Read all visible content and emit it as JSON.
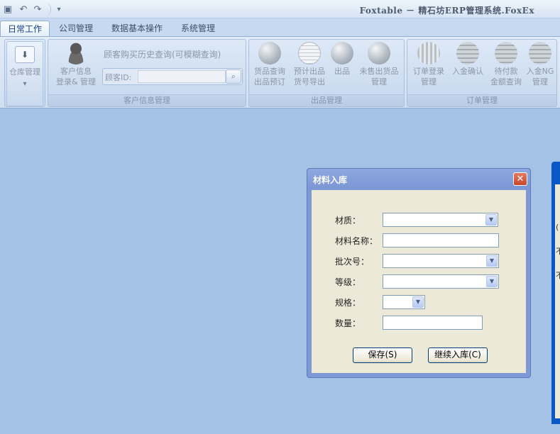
{
  "window": {
    "title": "Foxtable － 精石坊ERP管理系统.FoxEx"
  },
  "quick_access": {
    "icons": [
      "save-icon",
      "undo-icon",
      "redo-icon",
      "customize-icon"
    ]
  },
  "tabs": [
    {
      "label": "日常工作",
      "active": true
    },
    {
      "label": "公司管理",
      "active": false
    },
    {
      "label": "数据基本操作",
      "active": false
    },
    {
      "label": "系统管理",
      "active": false
    }
  ],
  "ribbon": {
    "warehouse_button": {
      "label": "仓库管理",
      "arrow": "▾",
      "icon": "download-icon"
    },
    "customer_group": {
      "caption": "客户信息管理",
      "customer_info_button": {
        "line1": "客户信息",
        "line2": "登录& 管理"
      },
      "history_label": "顾客购买历史查询(可模糊查询)",
      "customer_id_label": "顾客ID:",
      "customer_id_value": ""
    },
    "outbound_group": {
      "caption": "出品管理",
      "buttons": [
        {
          "line1": "货品查询",
          "line2": "出品预订",
          "icon": "magnifier-icon"
        },
        {
          "line1": "预计出品",
          "line2": "货号导出",
          "icon": "document-icon"
        },
        {
          "line1": "出品",
          "line2": "",
          "icon": "globe-icon"
        },
        {
          "line1": "未售出货品",
          "line2": "管理",
          "icon": "recycle-icon"
        }
      ]
    },
    "order_group": {
      "caption": "订单管理",
      "buttons": [
        {
          "line1": "订单登录",
          "line2": "管理",
          "icon": "basket-icon"
        },
        {
          "line1": "入金确认",
          "line2": "",
          "icon": "coins-icon"
        },
        {
          "line1": "待付款",
          "line2": "金额查询",
          "icon": "coins-hand-icon"
        },
        {
          "line1": "入金NG",
          "line2": "管理",
          "icon": "coins-cancel-icon"
        }
      ]
    }
  },
  "dialog": {
    "title": "材料入库",
    "close_symbol": "✕",
    "fields": {
      "material": {
        "label": "材质：",
        "value": ""
      },
      "material_name": {
        "label": "材料名称：",
        "value": ""
      },
      "batch_no": {
        "label": "批次号：",
        "value": ""
      },
      "grade": {
        "label": "等级：",
        "value": ""
      },
      "spec": {
        "label": "规格：",
        "value": ""
      },
      "quantity": {
        "label": "数量：",
        "value": ""
      }
    },
    "buttons": {
      "save": "保存(S)",
      "continue": "继续入库(C)"
    }
  },
  "edge_window": {
    "glyph1": "(",
    "glyph2": "不",
    "glyph3": "不"
  }
}
